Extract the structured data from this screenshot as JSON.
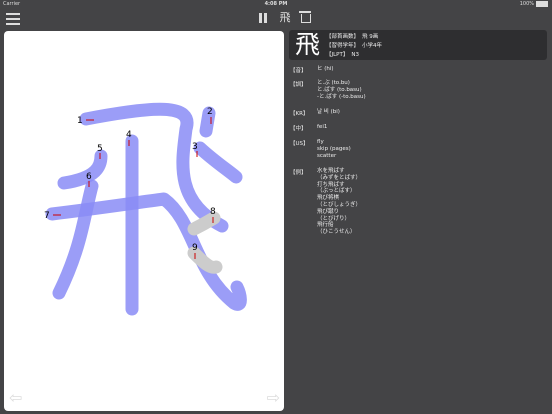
{
  "status": {
    "carrier": "Carrier",
    "time": "4:08 PM",
    "battery": "100%"
  },
  "toolbar": {
    "kanji_button": "飛"
  },
  "kanji": {
    "character": "飛"
  },
  "stroke_labels": [
    "1",
    "2",
    "3",
    "4",
    "5",
    "6",
    "7",
    "8",
    "9"
  ],
  "header": {
    "line1_label": "【部首画数】",
    "line1_value": "飛 9画",
    "line2_label": "【習得学年】",
    "line2_value": "小学4年",
    "line3_label": "【JLPT】",
    "line3_value": "N3"
  },
  "details": {
    "on_label": "【音】",
    "on_values": [
      "ヒ (hi)"
    ],
    "kun_label": "【訓】",
    "kun_values": [
      "と.ぶ (to.bu)",
      "と.ばす (to.basu)",
      "-と.ばす (-to.basu)"
    ],
    "kr_label": "【KR】",
    "kr_values": [
      "날 비 (bi)"
    ],
    "cn_label": "【中】",
    "cn_values": [
      "fei1"
    ],
    "en_label": "【US】",
    "en_values": [
      "fly",
      "skip (pages)",
      "scatter"
    ],
    "ex_label": "【例】",
    "ex_values": [
      "水を飛ばす",
      "（みずをとばす）",
      "打ち飛ばす",
      "（ぶっとばす）",
      "飛び将棋",
      "（とびしょうぎ）",
      "飛び蹴り",
      "（とびげり）",
      "飛行船",
      "（ひこうせん）"
    ]
  },
  "colors": {
    "stroke_done": "#8a8cf6",
    "stroke_pending": "#cccccc",
    "arrow": "#cc0000"
  }
}
